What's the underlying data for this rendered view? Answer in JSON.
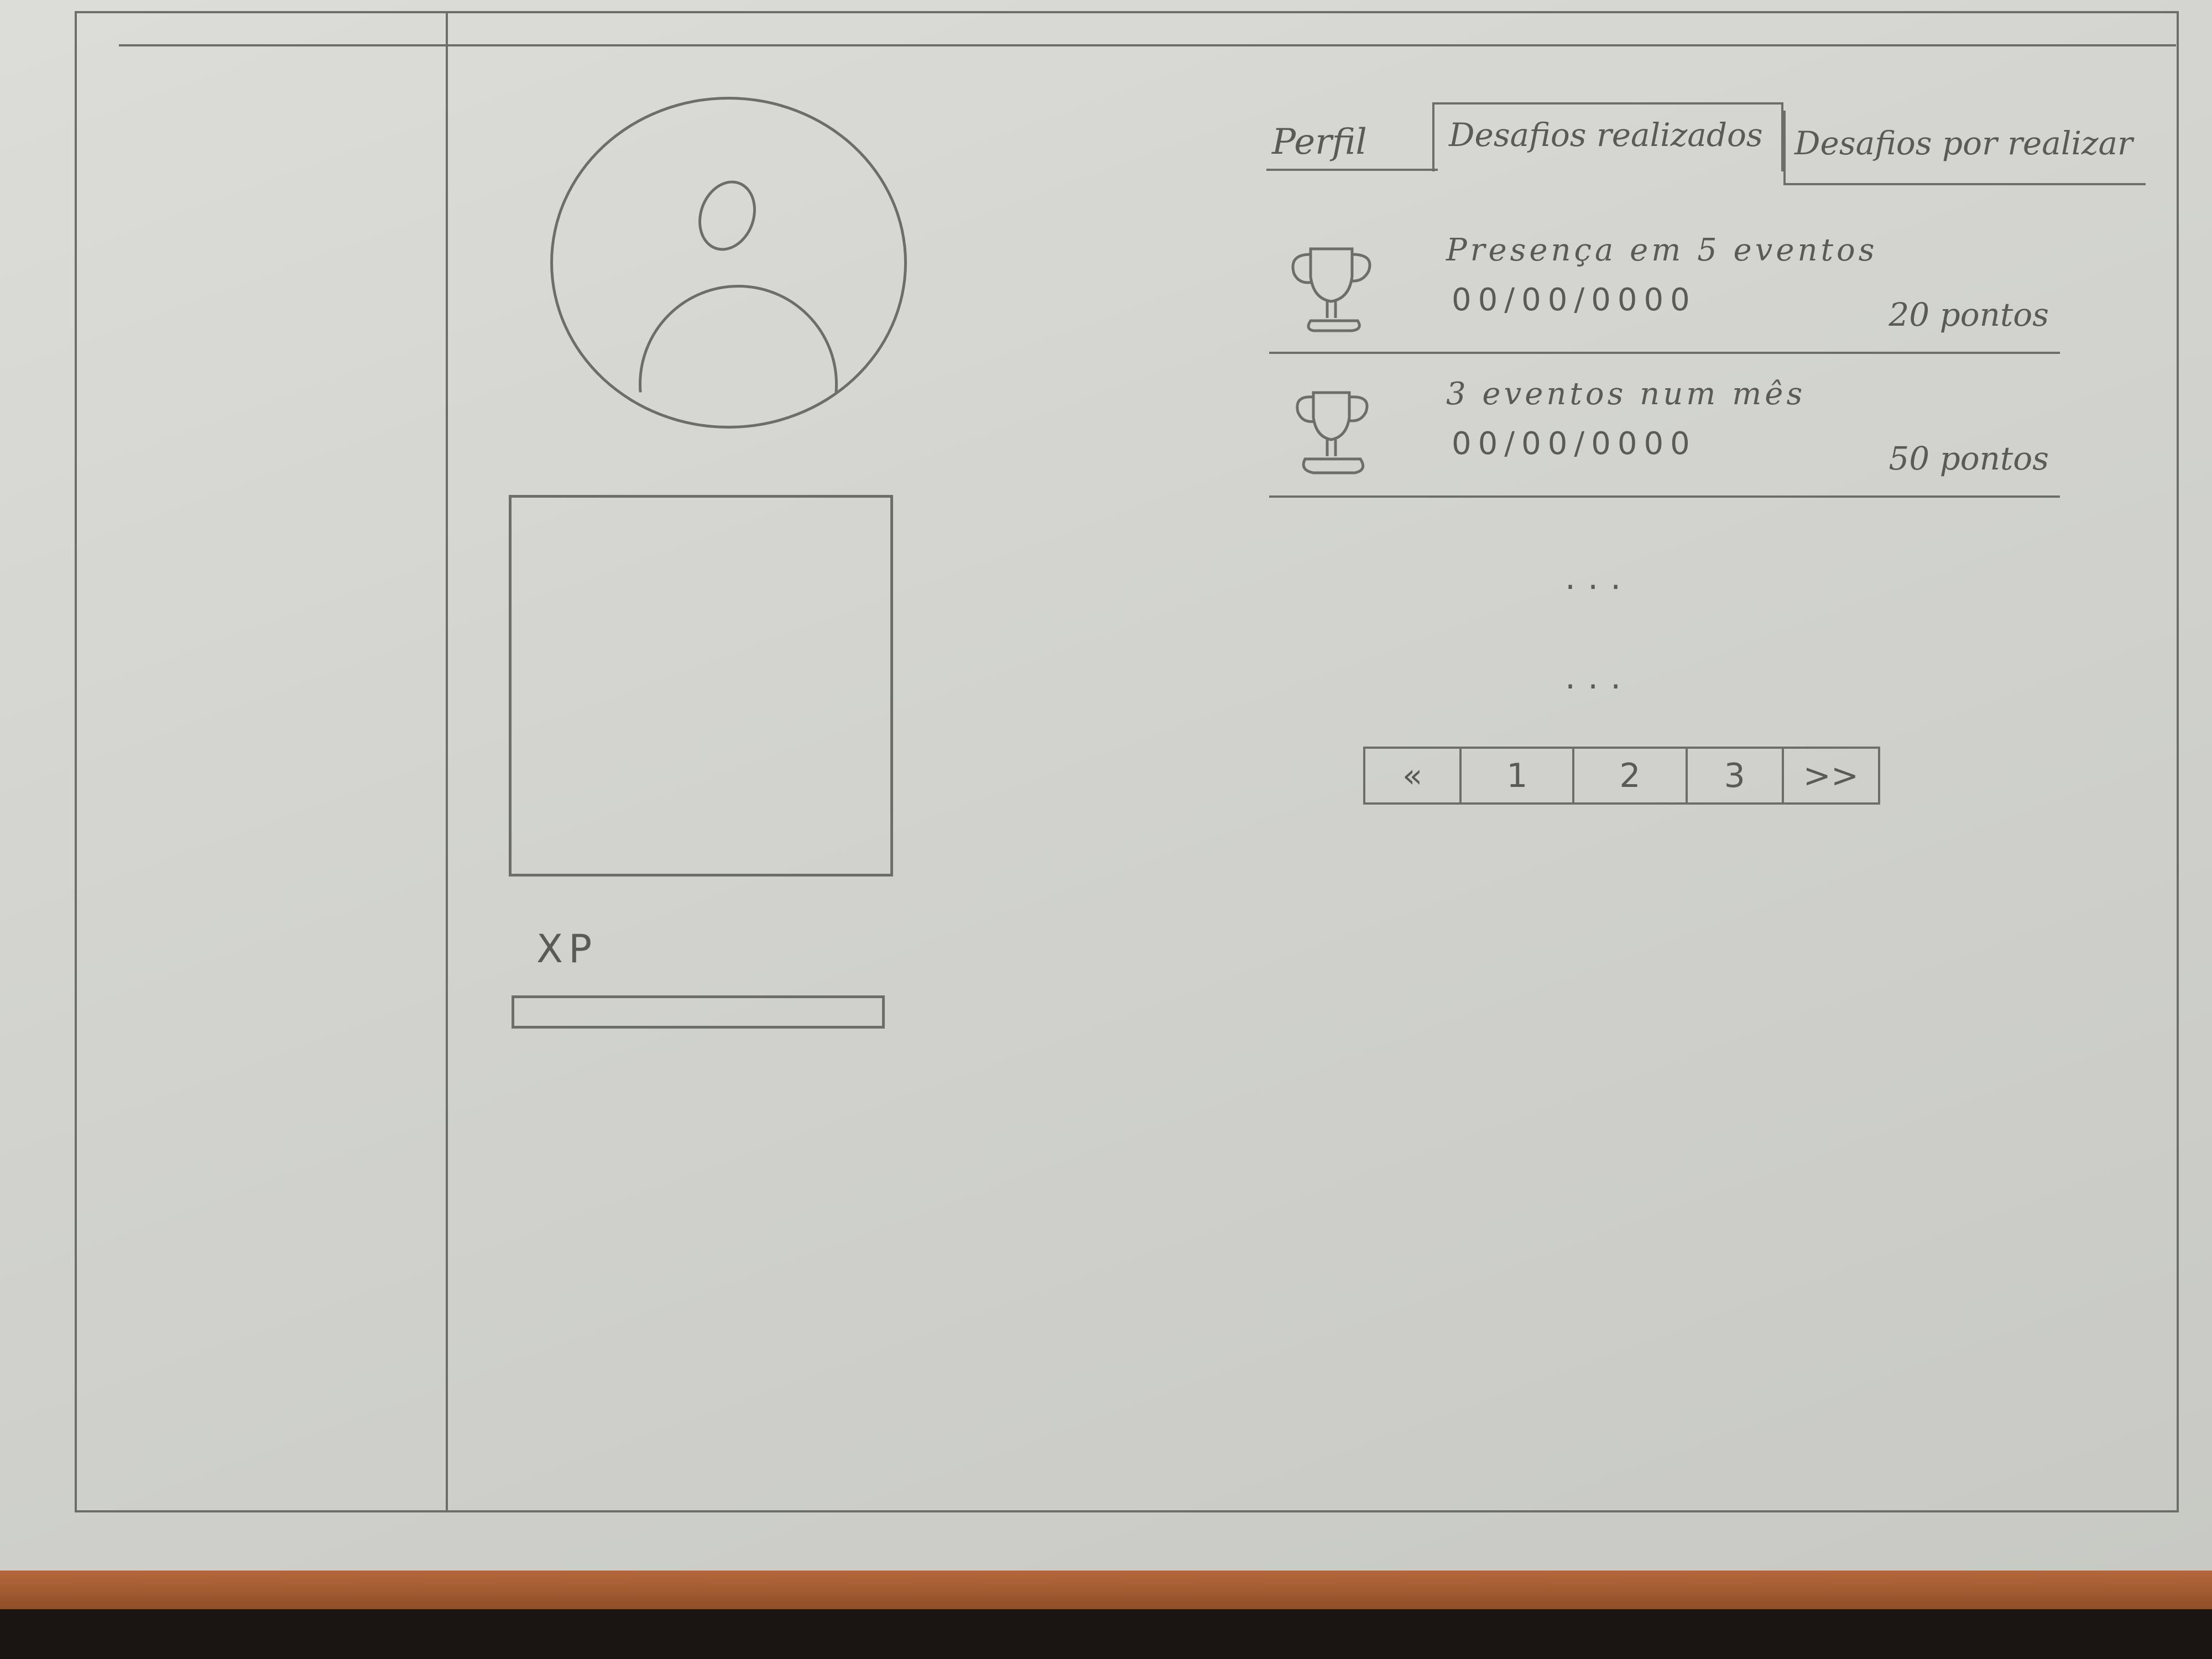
{
  "tabs": [
    {
      "label": "Perfil"
    },
    {
      "label": "Desafios realizados"
    },
    {
      "label": "Desafios por realizar"
    }
  ],
  "sidebar": {
    "xp_label": "XP",
    "xp_progress": 0
  },
  "challenges": [
    {
      "title": "Presença em 5 eventos",
      "date": "00/00/0000",
      "points": "20 pontos",
      "icon": "trophy-icon"
    },
    {
      "title": "3 eventos num mês",
      "date": "00/00/0000",
      "points": "50 pontos",
      "icon": "trophy-icon"
    }
  ],
  "more": [
    "...",
    "..."
  ],
  "pagination": {
    "prev": "«",
    "pages": [
      "1",
      "2",
      "3"
    ],
    "next": ">>"
  }
}
